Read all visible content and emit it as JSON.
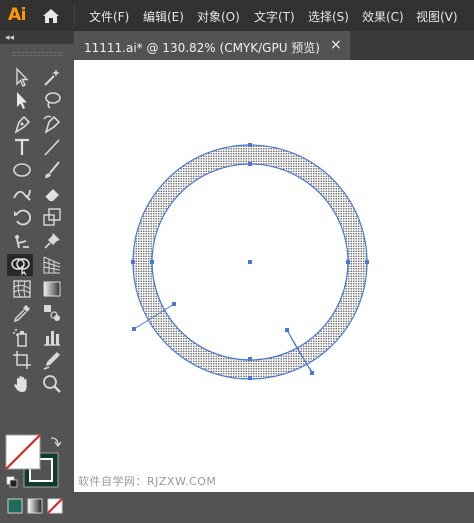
{
  "app": {
    "logo": "Ai"
  },
  "menu": {
    "items": [
      "文件(F)",
      "编辑(E)",
      "对象(O)",
      "文字(T)",
      "选择(S)",
      "效果(C)",
      "视图(V)"
    ]
  },
  "toolbar": {
    "collapse": "◂◂",
    "tools": [
      "selection-tool",
      "magic-wand-tool",
      "direct-selection-tool",
      "lasso-tool",
      "pen-tool",
      "curvature-tool",
      "type-tool",
      "line-segment-tool",
      "ellipse-tool",
      "paintbrush-tool",
      "shaper-tool",
      "eraser-tool",
      "rotate-tool",
      "scale-tool",
      "puppet-warp-tool",
      "pin-tool",
      "shape-builder-tool",
      "perspective-grid-tool",
      "mesh-tool",
      "gradient-tool",
      "eyedropper-tool",
      "blend-tool",
      "symbol-sprayer-tool",
      "column-graph-tool",
      "artboard-tool",
      "slice-tool",
      "hand-tool",
      "zoom-tool"
    ],
    "active_tool": "shape-builder-tool",
    "fill_color": "#ffffff",
    "stroke_color": "#1e4d3e"
  },
  "document": {
    "tab_title": "11111.ai* @ 130.82% (CMYK/GPU 预览)",
    "close": "×"
  },
  "canvas": {
    "selection_color": "#4a78d6",
    "ring_pattern": "dotted-fill"
  },
  "watermark": "软件自学网：RJZXW.COM"
}
